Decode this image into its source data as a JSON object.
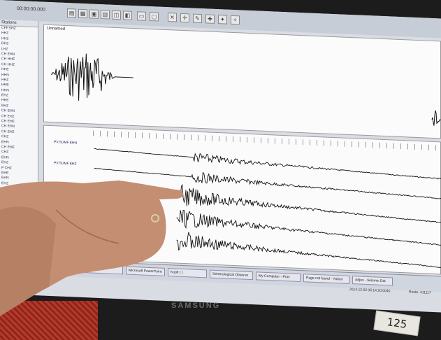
{
  "app": {
    "clock": "00:00:00.000"
  },
  "sidebar": {
    "header": "Stations",
    "items": [
      "CFP.SHZ",
      "HHZ",
      "HHZ",
      "DHZ",
      "LHZ",
      "CH EHN",
      "CH HHE",
      "CH HHZ",
      "HHE",
      "HHN",
      "HHZ",
      "HHE",
      "HHN",
      "EHZ",
      "HHE",
      "BHZ",
      "CH EHN",
      "CH EHZ",
      "CH EHE",
      "CH EHN",
      "CH EHZ",
      "CHZ",
      "EHN",
      "CH EHE",
      "CHZ",
      "EHN",
      "EHZ",
      "P CHZ",
      "EHE",
      "EHN",
      "EHZ"
    ]
  },
  "panels": {
    "top_label": "Unnamed",
    "channels": [
      "PV.SUMF.EHN",
      "PV.SUMF.EHZ"
    ]
  },
  "taskbar": {
    "items": [
      "Deneme",
      "Kopf ( )",
      "Microsoft PowerPoint",
      "Kopfi ( )",
      "Seismological Observe",
      "My Computer - Prov",
      "Page not found - Yahoo",
      "Adjes - Seismic Dat"
    ]
  },
  "status": {
    "datetime": "2014.12.02 05:14:20.0040",
    "extra": "Route: 411117"
  },
  "monitor": {
    "brand": "SAMSUNG",
    "sticker": "125"
  },
  "colors": {
    "screen_bg": "#d9dde3",
    "trace": "#111111",
    "keyboard": "#b33a2c"
  }
}
